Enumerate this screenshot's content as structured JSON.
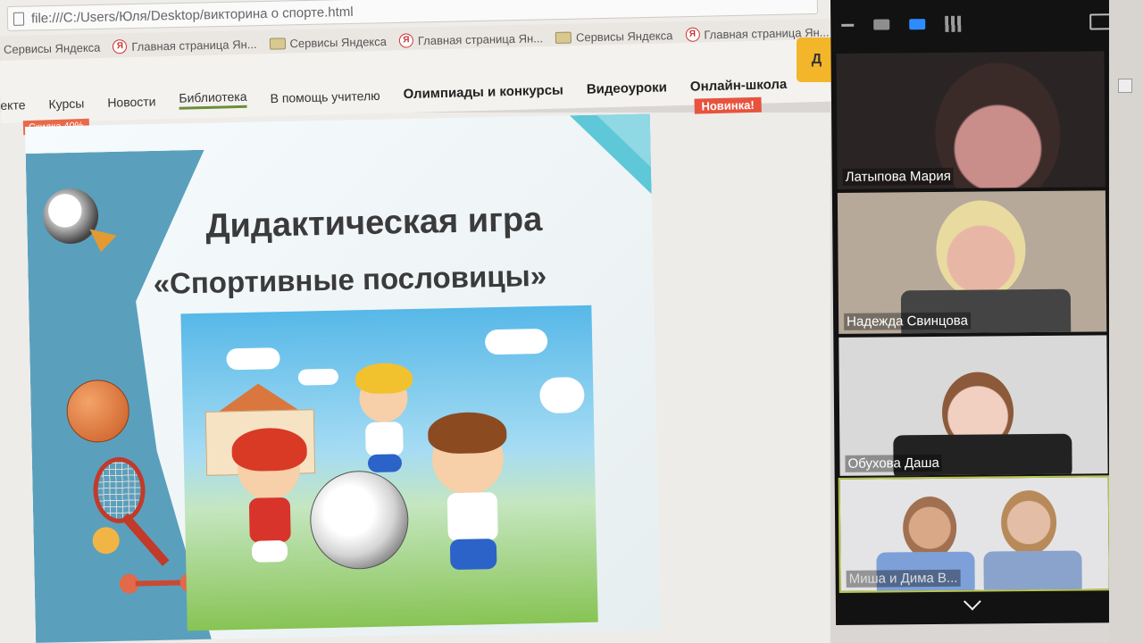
{
  "browser": {
    "url": "file:///C:/Users/Юля/Desktop/викторина о спорте.html",
    "bookmarks_top": [
      "Сервисы Яндекса",
      "Главная страница Ян...",
      "Сервисы Яндекса"
    ],
    "bookmarks": [
      "Сервисы Яндекса",
      "Главная страница Ян...",
      "Сервисы Яндекса",
      "Главная страница Ян...",
      "Сервисы Яндекса",
      "Главная страница Ян..."
    ]
  },
  "site_nav": {
    "items": [
      "екте",
      "Курсы",
      "Новости",
      "Библиотека",
      "В помощь учителю",
      "Олимпиады и конкурсы",
      "Видеоуроки",
      "Онлайн-школа"
    ],
    "new_badge": "Новинка!",
    "yellow_button": "Д",
    "discount": "Скидка 40%"
  },
  "slide": {
    "title": "Дидактическая игра",
    "subtitle": "«Спортивные пословицы»"
  },
  "zoom": {
    "participants": [
      {
        "name": "Латыпова Мария"
      },
      {
        "name": "Надежда Свинцова"
      },
      {
        "name": "Обухова Даша"
      },
      {
        "name": "Миша и Дима В..."
      }
    ]
  }
}
